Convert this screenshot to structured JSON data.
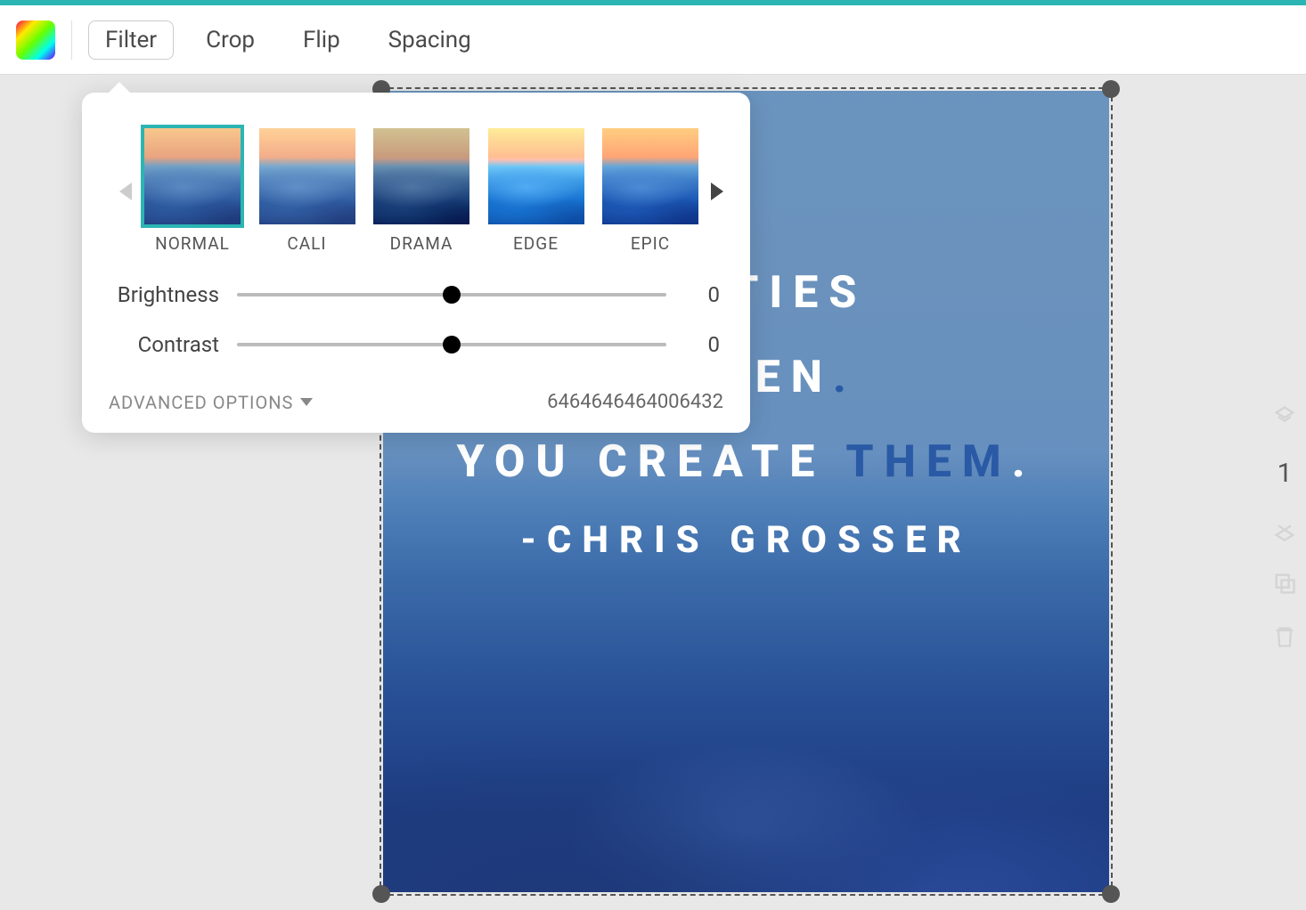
{
  "toolbar": {
    "tabs": [
      {
        "label": "Filter",
        "active": true
      },
      {
        "label": "Crop",
        "active": false
      },
      {
        "label": "Flip",
        "active": false
      },
      {
        "label": "Spacing",
        "active": false
      }
    ]
  },
  "filter_panel": {
    "filters": [
      {
        "label": "NORMAL",
        "selected": true,
        "style": "normal"
      },
      {
        "label": "CALI",
        "selected": false,
        "style": "cali"
      },
      {
        "label": "DRAMA",
        "selected": false,
        "style": "drama"
      },
      {
        "label": "EDGE",
        "selected": false,
        "style": "edge"
      },
      {
        "label": "EPIC",
        "selected": false,
        "style": "epic"
      }
    ],
    "sliders": {
      "brightness": {
        "label": "Brightness",
        "value": "0"
      },
      "contrast": {
        "label": "Contrast",
        "value": "0"
      }
    },
    "advanced_label": "ADVANCED OPTIONS",
    "code": "6464646464006432"
  },
  "canvas": {
    "line1a": "UNITIES",
    "line2a": "APPEN",
    "line2b": ".",
    "line3a": "YOU CREATE ",
    "line3b": "THEM",
    "line3c": ".",
    "line4": "-CHRIS GROSSER"
  },
  "side": {
    "page_label": "1"
  }
}
